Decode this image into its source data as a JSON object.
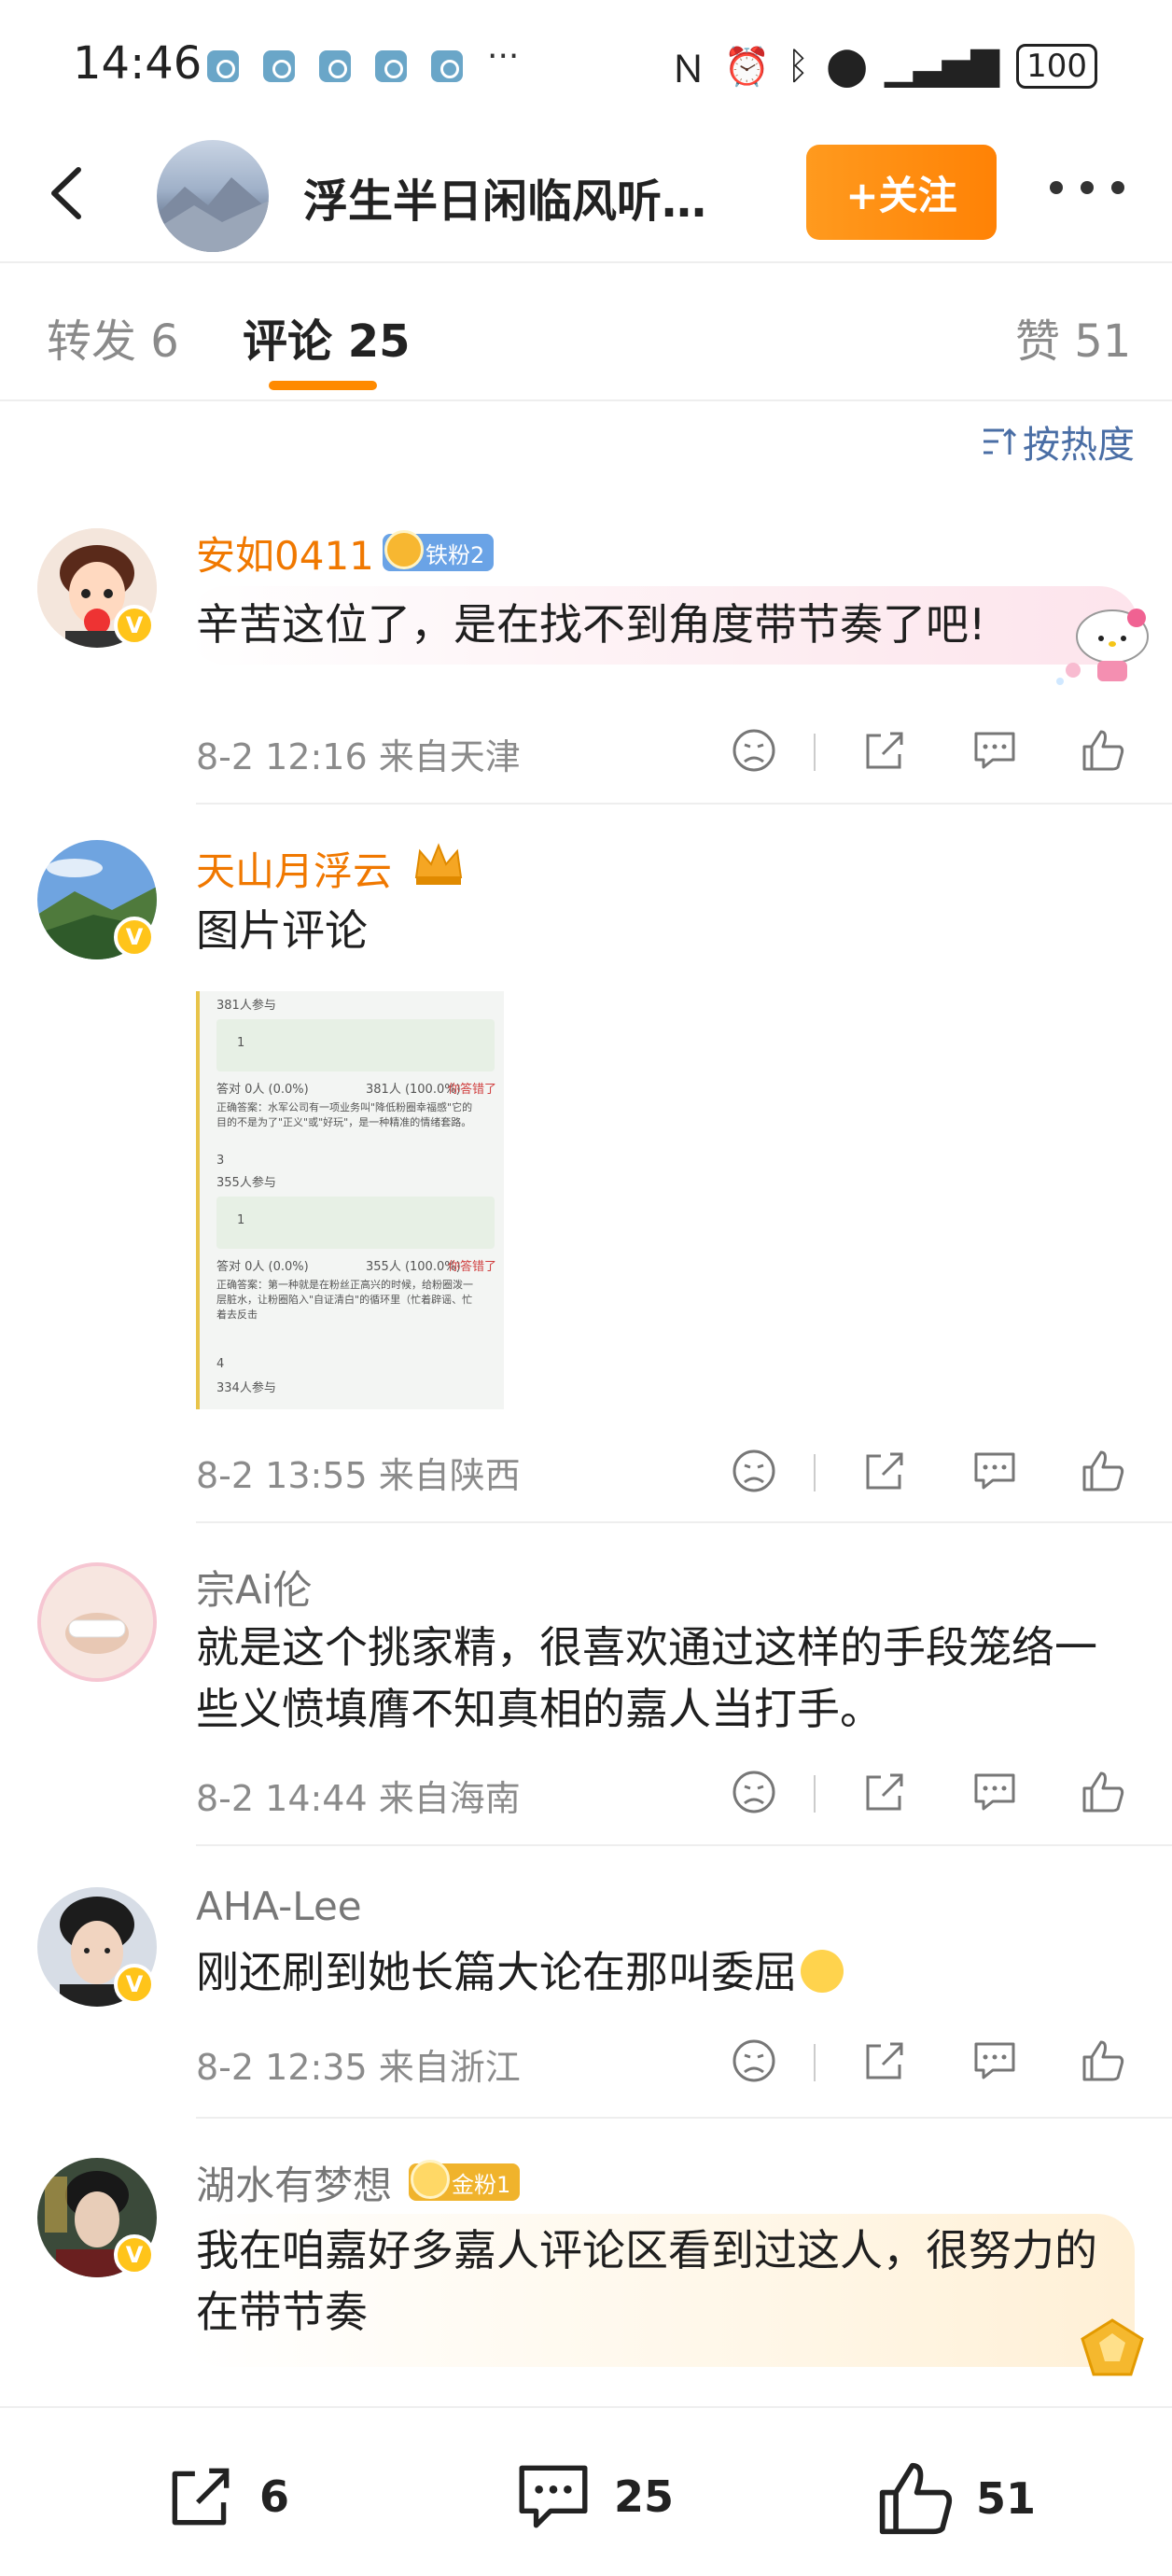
{
  "status_bar": {
    "time": "14:46",
    "more": "···",
    "battery": "100"
  },
  "header": {
    "title": "浮生半日闲临风听…",
    "follow_label": "+关注"
  },
  "tabs": [
    {
      "label": "转发 6"
    },
    {
      "label": "评论 25"
    },
    {
      "label": "赞 51"
    }
  ],
  "sort_label": "按热度",
  "comments": [
    {
      "name": "安如0411",
      "fan_badge": "铁粉2",
      "text": "辛苦这位了，是在找不到角度带节奏了吧!",
      "meta": "8-2 12:16  来自天津"
    },
    {
      "name": "天山月浮云",
      "text": "图片评论",
      "meta": "8-2 13:55  来自陕西",
      "image_text": {
        "l1": "381人参与",
        "l2": "1",
        "l3": "答对 0人 (0.0%)",
        "l4": "381人 (100.0%)",
        "l5": "你答错了",
        "l6": "正确答案：水军公司有一项业务叫\"降低粉圈幸福感\"它的",
        "l7": "目的不是为了\"正义\"或\"好玩\"，是一种精准的情绪套路。",
        "l8": "3",
        "l9": "355人参与",
        "l10": "1",
        "l11": "答对 0人 (0.0%)",
        "l12": "355人 (100.0%)",
        "l13": "你答错了",
        "l14": "正确答案：第一种就是在粉丝正高兴的时候，给粉圈泼一",
        "l15": "层脏水，让粉圈陷入\"自证清白\"的循环里（忙着辟谣、忙",
        "l16": "着去反击",
        "l17": "4",
        "l18": "334人参与"
      }
    },
    {
      "name": "宗Ai伦",
      "text": "就是这个挑家精，很喜欢通过这样的手段笼络一些义愤填膺不知真相的嘉人当打手。",
      "meta": "8-2 14:44  来自海南"
    },
    {
      "name": "AHA-Lee",
      "text": "刚还刷到她长篇大论在那叫委屈",
      "meta": "8-2 12:35  来自浙江"
    },
    {
      "name": "湖水有梦想",
      "fan_badge": "金粉1",
      "text": "我在咱嘉好多嘉人评论区看到过这人，很努力的在带节奏"
    }
  ],
  "bottom_bar": {
    "repost_count": "6",
    "comment_count": "25",
    "like_count": "51"
  },
  "colors": {
    "accent_orange": "#ff8a00",
    "name_orange": "#f07800",
    "link_blue": "#4a6ea5"
  }
}
